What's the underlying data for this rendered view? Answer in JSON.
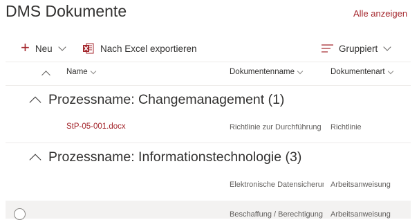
{
  "header": {
    "title": "DMS Dokumente",
    "show_all": "Alle anzeigen"
  },
  "toolbar": {
    "new_label": "Neu",
    "excel_label": "Nach Excel exportieren",
    "group_label": "Gruppiert",
    "accent_color": "#a4262c"
  },
  "columns": {
    "name": "Name",
    "dokumentenname": "Dokumentenname",
    "dokumentenart": "Dokumentenart"
  },
  "groups": [
    {
      "header": "Prozessname: Changemanagement (1)",
      "rows": [
        {
          "name": "StP-05-001.docx",
          "dokumentenname": "Richtlinie zur Durchführung",
          "dokumentenart": "Richtlinie"
        }
      ]
    },
    {
      "header": "Prozessname: Informationstechnologie (3)",
      "rows": [
        {
          "name": "",
          "dokumentenname": "Elektronische Datensicherung",
          "dokumentenart": "Arbeitsanweisung"
        },
        {
          "name": "",
          "dokumentenname": "Beschaffung / Berechtigung",
          "dokumentenart": "Arbeitsanweisung"
        }
      ]
    }
  ]
}
